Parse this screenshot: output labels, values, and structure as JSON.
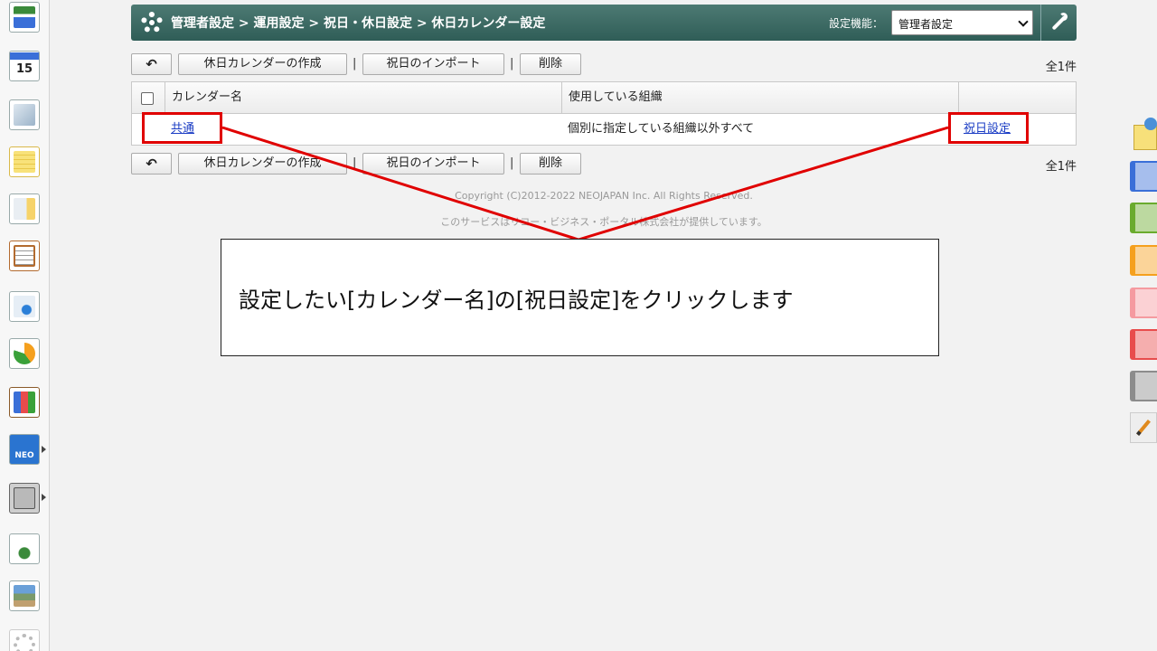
{
  "header": {
    "breadcrumb": "管理者設定 > 運用設定 > 祝日・休日設定 > 休日カレンダー設定",
    "settings_label": "設定機能：",
    "settings_value": "管理者設定"
  },
  "toolbar": {
    "create_label": "休日カレンダーの作成",
    "import_label": "祝日のインポート",
    "delete_label": "削除",
    "separator": "|",
    "count_label": "全1件"
  },
  "table": {
    "columns": [
      "カレンダー名",
      "使用している組織",
      ""
    ],
    "rows": [
      {
        "name": "共通",
        "org": "個別に指定している組織以外すべて",
        "action": "祝日設定"
      }
    ]
  },
  "footer": {
    "copyright": "Copyright (C)2012-2022 NEOJAPAN Inc. All Rights Reserved.",
    "provider": "このサービスはリコー・ビジネス・ポータル株式会社が提供しています。"
  },
  "annotation": {
    "callout_text": "設定したい[カレンダー名]の[祝日設定]をクリックします",
    "color": "#e00000"
  },
  "leftbar": {
    "calendar_day": "15",
    "neo_label": "NEO",
    "apps": [
      "portal-icon",
      "calendar-icon",
      "workflow-icon",
      "memo-icon",
      "bulletin-icon",
      "clipboard-icon",
      "search-doc-icon",
      "sync-icon",
      "cabinet-icon",
      "neo-chart-icon",
      "folder-icon",
      "tanomail-icon",
      "photo-icon",
      "settings-icon"
    ]
  },
  "right_tabs": {
    "colors": [
      "#3a6fd8",
      "#6aab2e",
      "#f5a01e",
      "#f59aa0",
      "#e84c4c",
      "#8c8c8c"
    ]
  }
}
